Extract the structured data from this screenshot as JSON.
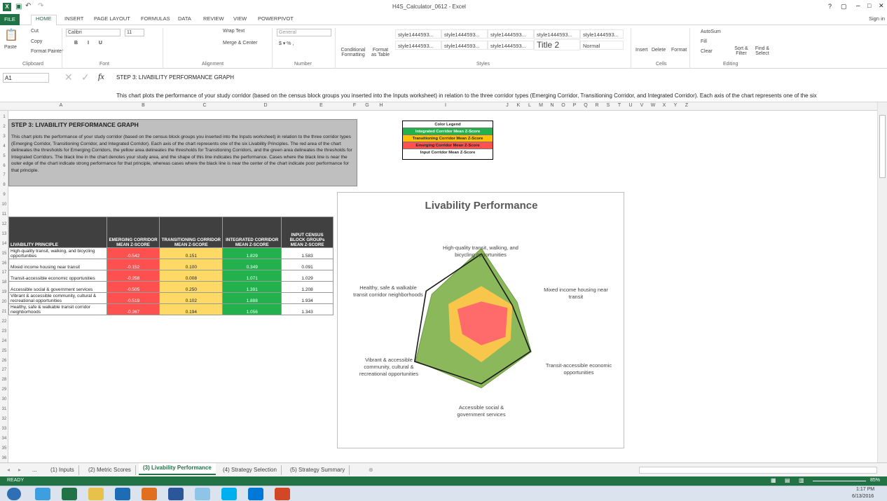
{
  "window": {
    "title": "H4S_Calculator_0612 - Excel",
    "help": "?",
    "minimize": "–",
    "close": "✕",
    "signin": "Sign in"
  },
  "ribbon_tabs": [
    "FILE",
    "HOME",
    "INSERT",
    "PAGE LAYOUT",
    "FORMULAS",
    "DATA",
    "REVIEW",
    "VIEW",
    "POWERPIVOT"
  ],
  "ribbon": {
    "cut": "Cut",
    "copy": "Copy",
    "paste": "Paste",
    "format_painter": "Format Painter",
    "clipboard": "Clipboard",
    "font_name": "Calibri",
    "font_size": "11",
    "font": "Font",
    "wrap_text": "Wrap Text",
    "merge_center": "Merge & Center",
    "alignment": "Alignment",
    "number_format": "General",
    "number": "Number",
    "cond_format": "Conditional Formatting",
    "format_table": "Format as Table",
    "styles": [
      "style1444593...",
      "style1444593...",
      "style1444593...",
      "style1444593...",
      "style1444593...",
      "style1444593...",
      "style1444593...",
      "style1444593...",
      "Title 2",
      "Normal"
    ],
    "styles_label": "Styles",
    "insert": "Insert",
    "delete": "Delete",
    "format": "Format",
    "cells": "Cells",
    "autosum": "AutoSum",
    "fill": "Fill",
    "clear": "Clear",
    "sort_filter": "Sort & Filter",
    "find_select": "Find & Select",
    "editing": "Editing"
  },
  "formula_bar": {
    "name_box": "A1",
    "fx": "fx",
    "line1": "STEP 3: LIVABILITY PERFORMANCE GRAPH",
    "line2": "This chart plots the performance of your study corridor (based on the census block groups you inserted into the Inputs worksheet) in relation to the three corridor types (Emerging Corridor, Transitioning Corridor, and Integrated Corridor).  Each axis of the chart represents one of the six"
  },
  "columns": [
    "A",
    "B",
    "C",
    "D",
    "E",
    "F",
    "G",
    "H",
    "I",
    "J",
    "K",
    "L",
    "M",
    "N",
    "O",
    "P",
    "Q",
    "R",
    "S",
    "T",
    "U",
    "V",
    "W",
    "X",
    "Y",
    "Z"
  ],
  "rows": [
    "1",
    "2",
    "3",
    "4",
    "5",
    "6",
    "7",
    "8",
    "9",
    "10",
    "11",
    "12",
    "13",
    "14",
    "15",
    "16",
    "17",
    "18",
    "19",
    "20",
    "21",
    "22",
    "23",
    "24",
    "25",
    "26",
    "27",
    "28",
    "29",
    "30",
    "31",
    "32",
    "33",
    "34",
    "35",
    "36"
  ],
  "intro": {
    "title": "STEP 3: LIVABILITY PERFORMANCE GRAPH",
    "body": "This chart plots the performance of your study corridor (based on the census block groups you inserted into the Inputs worksheet) in relation to the three corridor types (Emerging Corridor, Transitioning Corridor, and Integrated Corridor).  Each axis of the chart represents one of the six Livability Principles.  The red area of the chart delineates the thresholds for Emerging Corridors, the yellow area delineates the thresholds for Transitioning Corridors, and the green area delineates the thresholds for Integrated Corridors.  The black line in the chart denotes your study area, and the shape of this line indicates the performance.  Cases where the black line is near the outer edge of the chart indicate strong performance for that principle, whereas cases where the black line is near the center of the chart indicate poor performance for that principle."
  },
  "legend": {
    "title": "Color Legend",
    "items": [
      "Integrated Corridor Mean Z-Score",
      "Transitioning Corridor Mean Z-Score",
      "Emerging Corridor Mean Z-Score",
      "Input Corridor Mean Z-Score"
    ],
    "colors": [
      "#22b14c",
      "#ffc000",
      "#ff5050",
      "#ffffff"
    ]
  },
  "table": {
    "headers": [
      "LIVABILITY PRINCIPLE",
      "EMERGING CORRIDOR MEAN Z-SCORE",
      "TRANSITIONING CORRIDOR MEAN Z-SCORE",
      "INTEGRATED CORRIDOR MEAN Z-SCORE",
      "INPUT CENSUS BLOCK GROUPs MEAN Z-SCORE"
    ],
    "rows": [
      [
        "High-quality transit, walking, and bicycling opportunities",
        "-0.542",
        "0.151",
        "1.829",
        "1.583"
      ],
      [
        "Mixed income housing near transit",
        "-0.152",
        "0.100",
        "0.349",
        "0.091"
      ],
      [
        "Transit-accessible economic opportunities",
        "-0.258",
        "0.008",
        "1.071",
        "1.029"
      ],
      [
        "Accessible social & government services",
        "-0.505",
        "0.250",
        "1.391",
        "1.208"
      ],
      [
        "Vibrant & accessible community, cultural & recreational opportunities",
        "-0.519",
        "0.102",
        "1.888",
        "1.934"
      ],
      [
        "Healthy, safe & walkable transit corridor neighborhoods",
        "-0.267",
        "0.194",
        "1.056",
        "1.343"
      ]
    ]
  },
  "chart_data": {
    "type": "radar",
    "title": "Livability Performance",
    "categories": [
      "High-quality transit, walking, and bicycling opportunities",
      "Mixed income housing near transit",
      "Transit-accessible economic opportunities",
      "Accessible social & government services",
      "Vibrant & accessible community, cultural & recreational opportunities",
      "Healthy, safe & walkable transit corridor neighborhoods"
    ],
    "series": [
      {
        "name": "Integrated Corridor Mean Z-Score",
        "values": [
          1.829,
          0.349,
          1.071,
          1.391,
          1.888,
          1.056
        ],
        "color": "#8ab85a"
      },
      {
        "name": "Transitioning Corridor Mean Z-Score",
        "values": [
          0.151,
          0.1,
          0.008,
          0.25,
          0.102,
          0.194
        ],
        "color": "#f7c64a"
      },
      {
        "name": "Emerging Corridor Mean Z-Score",
        "values": [
          -0.542,
          -0.152,
          -0.258,
          -0.505,
          -0.519,
          -0.267
        ],
        "color": "#ff6b6b"
      },
      {
        "name": "Input Corridor Mean Z-Score",
        "values": [
          1.583,
          0.091,
          1.029,
          1.208,
          1.934,
          1.343
        ],
        "color": "#1a1a1a"
      }
    ]
  },
  "sheet_tabs": [
    "(1) Inputs",
    "(2) Metric Scores",
    "(3) Livability Performance",
    "(4) Strategy Selection",
    "(5) Strategy Summary"
  ],
  "status": {
    "ready": "READY",
    "zoom": "85%"
  },
  "clock": {
    "time": "1:17 PM",
    "date": "6/13/2016"
  }
}
